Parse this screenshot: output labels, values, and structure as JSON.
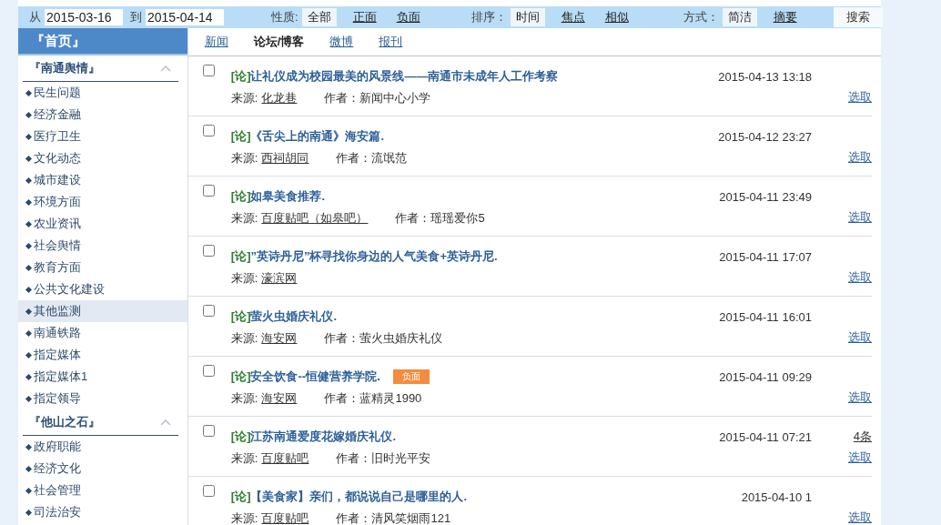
{
  "filter_bar": {
    "from_label": "从",
    "date_from": "2015-03-16",
    "to_label": "到",
    "date_to": "2015-04-14",
    "groups": [
      {
        "label": "性质:",
        "options": [
          {
            "label": "全部",
            "selected": true
          },
          {
            "label": "正面",
            "selected": false
          },
          {
            "label": "负面",
            "selected": false
          }
        ]
      },
      {
        "label": "排序：",
        "options": [
          {
            "label": "时间",
            "selected": true
          },
          {
            "label": "焦点",
            "selected": false
          },
          {
            "label": "相似",
            "selected": false
          }
        ]
      },
      {
        "label": "方式：",
        "options": [
          {
            "label": "简洁",
            "selected": true
          },
          {
            "label": "摘要",
            "selected": false
          }
        ]
      }
    ],
    "search_button": "搜索"
  },
  "sidebar": {
    "home": "『首页』",
    "sections": [
      {
        "title": "『南通舆情』",
        "expanded": true,
        "items": [
          {
            "label": "民生问题",
            "selected": false
          },
          {
            "label": "经济金融",
            "selected": false
          },
          {
            "label": "医疗卫生",
            "selected": false
          },
          {
            "label": "文化动态",
            "selected": false
          },
          {
            "label": "城市建设",
            "selected": false
          },
          {
            "label": "环境方面",
            "selected": false
          },
          {
            "label": "农业资讯",
            "selected": false
          },
          {
            "label": "社会舆情",
            "selected": false
          },
          {
            "label": "教育方面",
            "selected": false
          },
          {
            "label": "公共文化建设",
            "selected": false
          },
          {
            "label": "其他监测",
            "selected": true
          },
          {
            "label": "南通铁路",
            "selected": false
          },
          {
            "label": "指定媒体",
            "selected": false
          },
          {
            "label": "指定媒体1",
            "selected": false
          },
          {
            "label": "指定领导",
            "selected": false
          }
        ]
      },
      {
        "title": "『他山之石』",
        "expanded": true,
        "items": [
          {
            "label": "政府职能",
            "selected": false
          },
          {
            "label": "经济文化",
            "selected": false
          },
          {
            "label": "社会管理",
            "selected": false
          },
          {
            "label": "司法治安",
            "selected": false
          }
        ]
      }
    ]
  },
  "tabs": [
    {
      "label": "新闻",
      "selected": false
    },
    {
      "label": "论坛/博客",
      "selected": true
    },
    {
      "label": "微博",
      "selected": false
    },
    {
      "label": "报刊",
      "selected": false
    }
  ],
  "articles": [
    {
      "checked": false,
      "prefix": "[论]",
      "title": "让礼仪成为校园最美的风景线——南通市未成年人工作考察",
      "time": "2015-04-13 13:18",
      "source_label": "来源:",
      "source": "化龙巷",
      "author": "作者：新闻中心小学",
      "action": "选取"
    },
    {
      "checked": false,
      "prefix": "[论]",
      "title": "《舌尖上的南通》海安篇.",
      "time": "2015-04-12 23:27",
      "source_label": "来源:",
      "source": "西祠胡同",
      "author": "作者：流氓范",
      "action": "选取"
    },
    {
      "checked": false,
      "prefix": "[论]",
      "title": "如皋美食推荐.",
      "time": "2015-04-11 23:49",
      "source_label": "来源:",
      "source": "百度贴吧（如皋吧）",
      "author": "作者：瑶瑶爱你5",
      "action": "选取"
    },
    {
      "checked": false,
      "prefix": "[论]",
      "title": "”英诗丹尼”杯寻找你身边的人气美食+英诗丹尼.",
      "time": "2015-04-11 17:07",
      "source_label": "来源:",
      "source": "濠滨网",
      "action": "选取"
    },
    {
      "checked": false,
      "prefix": "[论]",
      "title": "萤火虫婚庆礼仪.",
      "time": "2015-04-11 16:01",
      "source_label": "来源:",
      "source": "海安网",
      "author": "作者：萤火虫婚庆礼仪",
      "action": "选取"
    },
    {
      "checked": false,
      "prefix": "[论]",
      "title": "安全饮食--恒健营养学院.",
      "tag": "负面",
      "time": "2015-04-11 09:29",
      "source_label": "来源:",
      "source": "海安网",
      "author": "作者：蓝精灵1990",
      "action": "选取"
    },
    {
      "checked": false,
      "prefix": "[论]",
      "title": "江苏南通爱度花嫁婚庆礼仪.",
      "time": "2015-04-11 07:21",
      "count": "4条",
      "source_label": "来源:",
      "source": "百度贴吧",
      "author": "作者：旧时光平安",
      "action": "选取"
    },
    {
      "checked": false,
      "prefix": "[论]",
      "title": "【美食家】亲们，都说说自己是哪里的人.",
      "time": "2015-04-10 1",
      "source_label": "来源:",
      "source": "百度贴吧",
      "author": "作者：清风笑烟雨121",
      "action": "选取"
    }
  ]
}
